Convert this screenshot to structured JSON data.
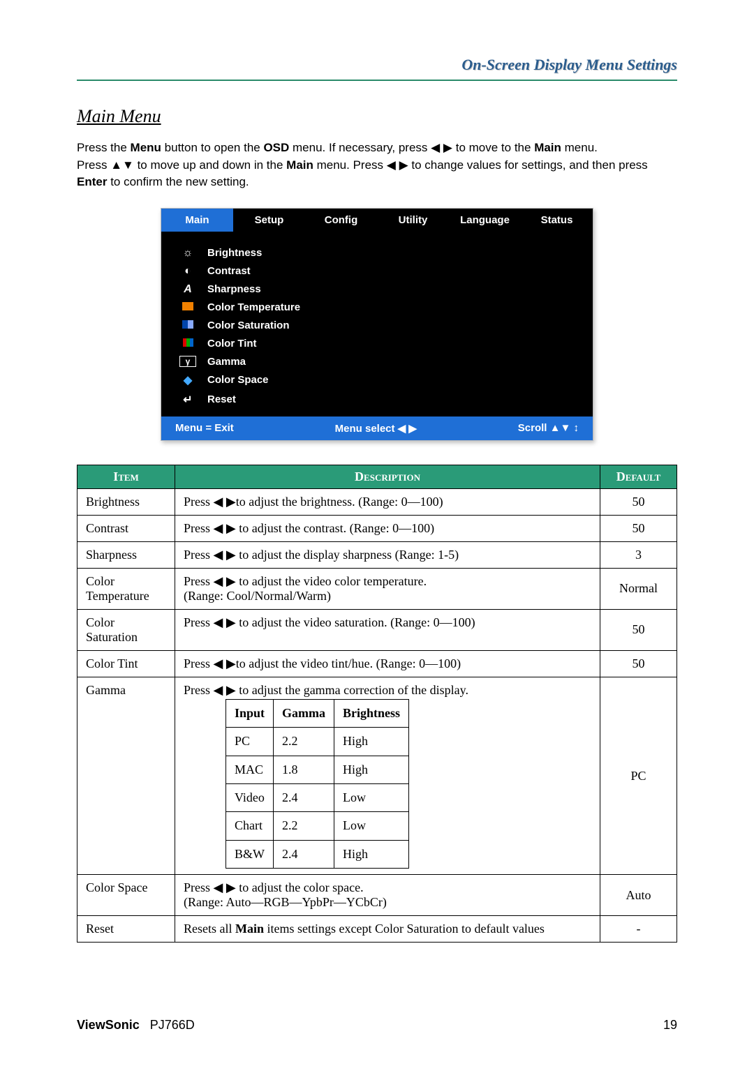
{
  "header_title": "On-Screen Display Menu Settings",
  "section_title": "Main Menu",
  "intro": {
    "line1a": "Press the ",
    "menu": "Menu",
    "line1b": " button to open the ",
    "osd": "OSD",
    "line1c": " menu. If necessary, press ",
    "arrows_lr": "◀ ▶",
    "line1d": " to move to the ",
    "main": "Main",
    "line1e": " menu.",
    "line2a": "Press ",
    "arrows_ud": "▲▼",
    "line2b": " to move up and down in the ",
    "main2": "Main",
    "line2c": " menu. Press ",
    "arrows_lr2": "◀ ▶",
    "line2d": " to change values for settings, and then press ",
    "enter": "Enter",
    "line2e": " to confirm the new setting."
  },
  "osd": {
    "tabs": [
      "Main",
      "Setup",
      "Config",
      "Utility",
      "Language",
      "Status"
    ],
    "active_tab_index": 0,
    "items": [
      {
        "icon": "☼",
        "label": "Brightness"
      },
      {
        "icon": "◐",
        "label": "Contrast"
      },
      {
        "icon": "A",
        "label": "Sharpness"
      },
      {
        "icon": "orange",
        "label": "Color Temperature"
      },
      {
        "icon": "sat",
        "label": "Color Saturation"
      },
      {
        "icon": "tint",
        "label": "Color Tint"
      },
      {
        "icon": "γ",
        "label": "Gamma"
      },
      {
        "icon": "space",
        "label": "Color Space"
      },
      {
        "icon": "↵",
        "label": "Reset"
      }
    ],
    "footer_left": "Menu = Exit",
    "footer_mid": "Menu select  ◀ ▶",
    "footer_right": "Scroll  ▲▼  ↕"
  },
  "table": {
    "headers": {
      "item": "Item",
      "desc": "Description",
      "def": "Default"
    },
    "arrow_lr": "◀ ▶",
    "rows": [
      {
        "item": "Brightness",
        "desc_pre": "Press ",
        "desc_post": "to adjust the brightness. (Range: 0—100)",
        "default": "50"
      },
      {
        "item": "Contrast",
        "desc_pre": "Press ",
        "desc_post": " to adjust the contrast. (Range: 0—100)",
        "default": "50"
      },
      {
        "item": "Sharpness",
        "desc_pre": "Press ",
        "desc_post": " to adjust the display sharpness (Range: 1-5)",
        "default": "3"
      },
      {
        "item": "Color Temperature",
        "desc_pre": "Press ",
        "desc_post": " to adjust the video color temperature.",
        "desc_extra": "(Range: Cool/Normal/Warm)",
        "default": "Normal"
      },
      {
        "item": "Color Saturation",
        "desc_pre": "Press ",
        "desc_post": " to adjust the video saturation. (Range: 0—100)",
        "default": "50"
      },
      {
        "item": "Color Tint",
        "desc_pre": "Press ",
        "desc_post": "to adjust the video tint/hue. (Range: 0—100)",
        "default": "50"
      },
      {
        "item": "Gamma",
        "desc_pre": "Press ",
        "desc_post": " to adjust the gamma correction of the display.",
        "default": "PC",
        "sub_headers": {
          "c1": "Input",
          "c2": "Gamma",
          "c3": "Brightness"
        },
        "sub_rows": [
          {
            "c1": "PC",
            "c2": "2.2",
            "c3": "High"
          },
          {
            "c1": "MAC",
            "c2": "1.8",
            "c3": "High"
          },
          {
            "c1": "Video",
            "c2": "2.4",
            "c3": "Low"
          },
          {
            "c1": "Chart",
            "c2": "2.2",
            "c3": "Low"
          },
          {
            "c1": "B&W",
            "c2": "2.4",
            "c3": "High"
          }
        ]
      },
      {
        "item": "Color Space",
        "desc_pre": "Press ",
        "desc_post": " to adjust the color space.",
        "desc_extra": "(Range: Auto—RGB—YpbPr—YCbCr)",
        "default": "Auto"
      },
      {
        "item": "Reset",
        "desc_plain_a": "Resets all ",
        "desc_bold": "Main",
        "desc_plain_b": " items settings except Color Saturation to default values",
        "default": "-"
      }
    ]
  },
  "footer": {
    "brand": "ViewSonic",
    "model": "PJ766D",
    "page": "19"
  }
}
